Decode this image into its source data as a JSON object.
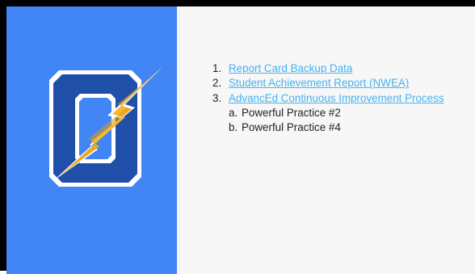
{
  "slide": {
    "panel_color": "#4285f4",
    "background_color": "#f7f7f7",
    "link_color": "#45b3f0",
    "logo": {
      "icon": "o-lightning-bolt-logo",
      "letter_fill": "#1f4fa8",
      "letter_outline": "#ffffff",
      "bolt_fill": "#f5b82e"
    },
    "list": {
      "items": [
        {
          "label": "Report Card Backup Data"
        },
        {
          "label": "Student Achievement Report (NWEA)"
        },
        {
          "label": "AdvancEd Continuous Improvement Process",
          "subitems": [
            {
              "label": "Powerful Practice #2"
            },
            {
              "label": "Powerful Practice #4"
            }
          ]
        }
      ]
    }
  }
}
